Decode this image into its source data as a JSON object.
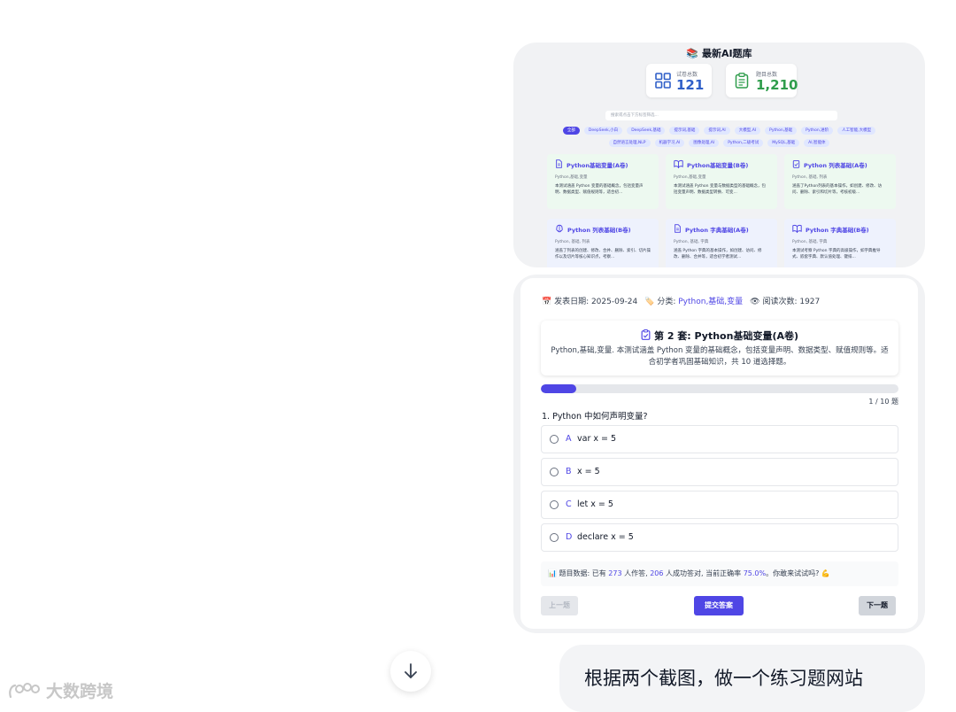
{
  "library": {
    "title": "📚 最新AI题库",
    "stats": [
      {
        "label": "试卷总数",
        "value": "121",
        "color": "#2f5fc8",
        "icon": "grid-icon"
      },
      {
        "label": "题目总数",
        "value": "1,210",
        "color": "#2f9d4c",
        "icon": "clipboard-icon"
      }
    ],
    "search_placeholder": "搜索或点击下方标签筛选...",
    "tags_row1": [
      "全部",
      "DeepSeek,小白",
      "DeepSeek,基础",
      "提示词,基础",
      "提示词,AI",
      "大模型,AI",
      "Python,基础",
      "Python,进阶",
      "人工智能,大模型"
    ],
    "tags_row2": [
      "自然语言处理,NLP",
      "机器学习,AI",
      "图像处理,AI",
      "Python,二级考试",
      "MySQL,基础",
      "AI,智能体"
    ],
    "cards": [
      {
        "title": "Python基础变量(A卷)",
        "sub": "Python,基础,变量",
        "desc": "本测试涵盖 Python 变量的基础概念，包括变量声明、数据类型、赋值规则等，适合初...",
        "icon": "document-icon",
        "tone": "green"
      },
      {
        "title": "Python基础变量(B卷)",
        "sub": "Python,基础,变量",
        "desc": "本测试涵盖 Python 变量与数据类型的基础概念，包括变量声明、数据类型转换、可变...",
        "icon": "book-icon",
        "tone": "green"
      },
      {
        "title": "Python 列表基础(A卷)",
        "sub": "Python, 基础, 列表",
        "desc": "涵盖了Python列表的基本操作，如创建、修改、访问、删除、索引和切片等，考核初级...",
        "icon": "clipboard-icon",
        "tone": "green"
      },
      {
        "title": "Python 列表基础(B卷)",
        "sub": "Python, 基础, 列表",
        "desc": "涵盖了列表的创建、修改、合并、删除、索引、切片操作以及切片等核心知识点，考察...",
        "icon": "brain-icon",
        "tone": "blue"
      },
      {
        "title": "Python 字典基础(A卷)",
        "sub": "Python, 基础, 字典",
        "desc": "涵盖 Python 字典的基本操作，如创建、访问、修改、删除、合并等，适合初学者测试...",
        "icon": "document-icon",
        "tone": "blue"
      },
      {
        "title": "Python 字典基础(B卷)",
        "sub": "Python, 基础, 字典",
        "desc": "本测试考察 Python 字典的高级操作，如字典推导式、嵌套字典、默认值处理、键排...",
        "icon": "book-icon",
        "tone": "blue"
      }
    ]
  },
  "quiz": {
    "meta": {
      "date_label": "📅 发表日期: 2025-09-24",
      "category_prefix": "🏷️ 分类:",
      "category_value": "Python,基础,变量",
      "views_label": "👁 阅读次数: 1927"
    },
    "title": "第 2 套: Python基础变量(A卷)",
    "description": "Python,基础,变量. 本测试涵盖 Python 变量的基础概念，包括变量声明、数据类型、赋值规则等。适合初学者巩固基础知识，共 10 道选择题。",
    "progress": 0.1,
    "progress_text": "1 / 10 题",
    "question": "1. Python 中如何声明变量?",
    "options": [
      {
        "letter": "A",
        "text": "var x = 5"
      },
      {
        "letter": "B",
        "text": "x = 5"
      },
      {
        "letter": "C",
        "text": "let x = 5"
      },
      {
        "letter": "D",
        "text": "declare x = 5"
      }
    ],
    "stats": {
      "prefix": "📊 题目数据: 已有",
      "answered": "273",
      "mid1": "人作答,",
      "correct": "206",
      "mid2": "人成功答对,  当前正确率",
      "rate": "75.0%",
      "suffix": "。你敢来试试吗? 💪"
    },
    "buttons": {
      "prev": "上一题",
      "submit": "提交答案",
      "next": "下一题"
    }
  },
  "chat": {
    "message": "根据两个截图，做一个练习题网站"
  },
  "watermark": {
    "text": "大数跨境"
  }
}
